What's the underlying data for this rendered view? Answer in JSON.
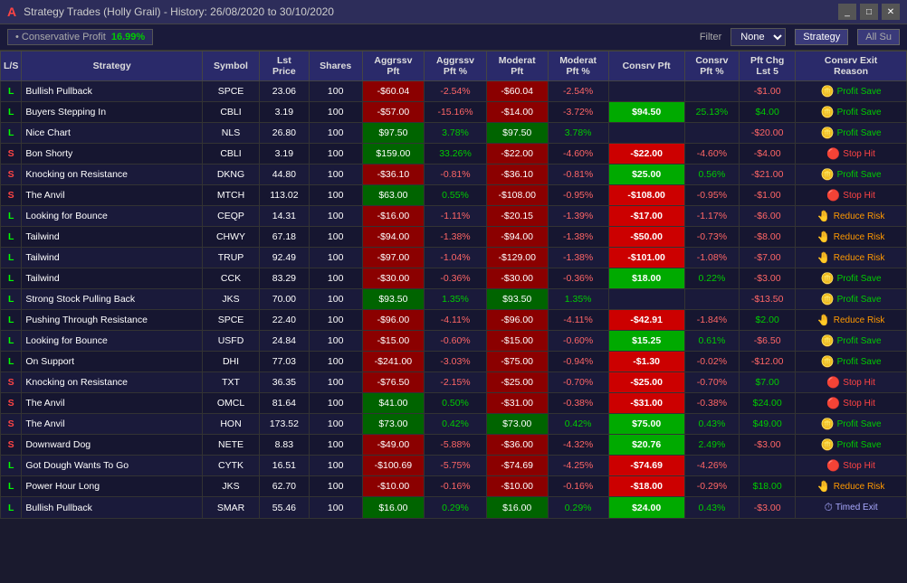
{
  "titleBar": {
    "icon": "A",
    "title": "Strategy Trades (Holly Grail) - History: 26/08/2020 to 30/10/2020",
    "minimizeLabel": "_",
    "maximizeLabel": "□",
    "closeLabel": "✕"
  },
  "toolbar": {
    "profitLabel": "• Conservative Profit",
    "profitValue": "16.99%",
    "filterLabel": "Filter",
    "filterValue": "None",
    "strategyLabel": "Strategy",
    "allLabel": "All Su"
  },
  "tableHeaders": [
    "L/S",
    "Strategy",
    "Symbol",
    "Lst\nPrice",
    "Shares",
    "Aggrssv\nPft",
    "Aggrssv\nPft %",
    "Moderat\nPft",
    "Moderat\nPft %",
    "Consrv Pft",
    "Consrv\nPft %",
    "Pft Chg\nLst 5",
    "Consrv Exit\nReason"
  ],
  "rows": [
    {
      "ls": "L",
      "strategy": "Bullish Pullback",
      "symbol": "SPCE",
      "price": "23.06",
      "shares": "100",
      "aggrPft": "-$60.04",
      "aggrPct": "-2.54%",
      "modPft": "-$60.04",
      "modPct": "-2.54%",
      "consrvPft": "",
      "consrvPct": "",
      "pftChg": "-$1.00",
      "exitIcon": "coin",
      "exitText": "Profit Save",
      "exitType": "profit"
    },
    {
      "ls": "L",
      "strategy": "Buyers Stepping In",
      "symbol": "CBLI",
      "price": "3.19",
      "shares": "100",
      "aggrPft": "-$57.00",
      "aggrPct": "-15.16%",
      "modPft": "-$14.00",
      "modPct": "-3.72%",
      "consrvPft": "$94.50",
      "consrvPct": "25.13%",
      "pftChg": "$4.00",
      "exitIcon": "coin",
      "exitText": "Profit Save",
      "exitType": "profit",
      "highlight": true
    },
    {
      "ls": "L",
      "strategy": "Nice Chart",
      "symbol": "NLS",
      "price": "26.80",
      "shares": "100",
      "aggrPft": "$97.50",
      "aggrPct": "3.78%",
      "modPft": "$97.50",
      "modPct": "3.78%",
      "consrvPft": "",
      "consrvPct": "",
      "pftChg": "-$20.00",
      "exitIcon": "coin",
      "exitText": "Profit Save",
      "exitType": "profit"
    },
    {
      "ls": "S",
      "strategy": "Bon Shorty",
      "symbol": "CBLI",
      "price": "3.19",
      "shares": "100",
      "aggrPft": "$159.00",
      "aggrPct": "33.26%",
      "modPft": "-$22.00",
      "modPct": "-4.60%",
      "consrvPft": "-$22.00",
      "consrvPct": "-4.60%",
      "pftChg": "-$4.00",
      "exitIcon": "stop",
      "exitText": "Stop Hit",
      "exitType": "stop"
    },
    {
      "ls": "S",
      "strategy": "Knocking on Resistance",
      "symbol": "DKNG",
      "price": "44.80",
      "shares": "100",
      "aggrPft": "-$36.10",
      "aggrPct": "-0.81%",
      "modPft": "-$36.10",
      "modPct": "-0.81%",
      "consrvPft": "$25.00",
      "consrvPct": "0.56%",
      "pftChg": "-$21.00",
      "exitIcon": "coin",
      "exitText": "Profit Save",
      "exitType": "profit"
    },
    {
      "ls": "S",
      "strategy": "The Anvil",
      "symbol": "MTCH",
      "price": "113.02",
      "shares": "100",
      "aggrPft": "$63.00",
      "aggrPct": "0.55%",
      "modPft": "-$108.00",
      "modPct": "-0.95%",
      "consrvPft": "-$108.00",
      "consrvPct": "-0.95%",
      "pftChg": "-$1.00",
      "exitIcon": "stop",
      "exitText": "Stop Hit",
      "exitType": "stop"
    },
    {
      "ls": "L",
      "strategy": "Looking for Bounce",
      "symbol": "CEQP",
      "price": "14.31",
      "shares": "100",
      "aggrPft": "-$16.00",
      "aggrPct": "-1.11%",
      "modPft": "-$20.15",
      "modPct": "-1.39%",
      "consrvPft": "-$17.00",
      "consrvPct": "-1.17%",
      "pftChg": "-$6.00",
      "exitIcon": "hand",
      "exitText": "Reduce Risk",
      "exitType": "reduce"
    },
    {
      "ls": "L",
      "strategy": "Tailwind",
      "symbol": "CHWY",
      "price": "67.18",
      "shares": "100",
      "aggrPft": "-$94.00",
      "aggrPct": "-1.38%",
      "modPft": "-$94.00",
      "modPct": "-1.38%",
      "consrvPft": "-$50.00",
      "consrvPct": "-0.73%",
      "pftChg": "-$8.00",
      "exitIcon": "hand",
      "exitText": "Reduce Risk",
      "exitType": "reduce"
    },
    {
      "ls": "L",
      "strategy": "Tailwind",
      "symbol": "TRUP",
      "price": "92.49",
      "shares": "100",
      "aggrPft": "-$97.00",
      "aggrPct": "-1.04%",
      "modPft": "-$129.00",
      "modPct": "-1.38%",
      "consrvPft": "-$101.00",
      "consrvPct": "-1.08%",
      "pftChg": "-$7.00",
      "exitIcon": "hand",
      "exitText": "Reduce Risk",
      "exitType": "reduce"
    },
    {
      "ls": "L",
      "strategy": "Tailwind",
      "symbol": "CCK",
      "price": "83.29",
      "shares": "100",
      "aggrPft": "-$30.00",
      "aggrPct": "-0.36%",
      "modPft": "-$30.00",
      "modPct": "-0.36%",
      "consrvPft": "$18.00",
      "consrvPct": "0.22%",
      "pftChg": "-$3.00",
      "exitIcon": "coin",
      "exitText": "Profit Save",
      "exitType": "profit"
    },
    {
      "ls": "L",
      "strategy": "Strong Stock Pulling Back",
      "symbol": "JKS",
      "price": "70.00",
      "shares": "100",
      "aggrPft": "$93.50",
      "aggrPct": "1.35%",
      "modPft": "$93.50",
      "modPct": "1.35%",
      "consrvPft": "",
      "consrvPct": "",
      "pftChg": "-$13.50",
      "exitIcon": "coin",
      "exitText": "Profit Save",
      "exitType": "profit"
    },
    {
      "ls": "L",
      "strategy": "Pushing Through Resistance",
      "symbol": "SPCE",
      "price": "22.40",
      "shares": "100",
      "aggrPft": "-$96.00",
      "aggrPct": "-4.11%",
      "modPft": "-$96.00",
      "modPct": "-4.11%",
      "consrvPft": "-$42.91",
      "consrvPct": "-1.84%",
      "pftChg": "$2.00",
      "exitIcon": "hand",
      "exitText": "Reduce Risk",
      "exitType": "reduce"
    },
    {
      "ls": "L",
      "strategy": "Looking for Bounce",
      "symbol": "USFD",
      "price": "24.84",
      "shares": "100",
      "aggrPft": "-$15.00",
      "aggrPct": "-0.60%",
      "modPft": "-$15.00",
      "modPct": "-0.60%",
      "consrvPft": "$15.25",
      "consrvPct": "0.61%",
      "pftChg": "-$6.50",
      "exitIcon": "coin",
      "exitText": "Profit Save",
      "exitType": "profit"
    },
    {
      "ls": "L",
      "strategy": "On Support",
      "symbol": "DHI",
      "price": "77.03",
      "shares": "100",
      "aggrPft": "-$241.00",
      "aggrPct": "-3.03%",
      "modPft": "-$75.00",
      "modPct": "-0.94%",
      "consrvPft": "-$1.30",
      "consrvPct": "-0.02%",
      "pftChg": "-$12.00",
      "exitIcon": "coin",
      "exitText": "Profit Save",
      "exitType": "profit"
    },
    {
      "ls": "S",
      "strategy": "Knocking on Resistance",
      "symbol": "TXT",
      "price": "36.35",
      "shares": "100",
      "aggrPft": "-$76.50",
      "aggrPct": "-2.15%",
      "modPft": "-$25.00",
      "modPct": "-0.70%",
      "consrvPft": "-$25.00",
      "consrvPct": "-0.70%",
      "pftChg": "$7.00",
      "exitIcon": "stop",
      "exitText": "Stop Hit",
      "exitType": "stop"
    },
    {
      "ls": "S",
      "strategy": "The Anvil",
      "symbol": "OMCL",
      "price": "81.64",
      "shares": "100",
      "aggrPft": "$41.00",
      "aggrPct": "0.50%",
      "modPft": "-$31.00",
      "modPct": "-0.38%",
      "consrvPft": "-$31.00",
      "consrvPct": "-0.38%",
      "pftChg": "$24.00",
      "exitIcon": "stop",
      "exitText": "Stop Hit",
      "exitType": "stop"
    },
    {
      "ls": "S",
      "strategy": "The Anvil",
      "symbol": "HON",
      "price": "173.52",
      "shares": "100",
      "aggrPft": "$73.00",
      "aggrPct": "0.42%",
      "modPft": "$73.00",
      "modPct": "0.42%",
      "consrvPft": "$75.00",
      "consrvPct": "0.43%",
      "pftChg": "$49.00",
      "exitIcon": "coin",
      "exitText": "Profit Save",
      "exitType": "profit"
    },
    {
      "ls": "S",
      "strategy": "Downward Dog",
      "symbol": "NETE",
      "price": "8.83",
      "shares": "100",
      "aggrPft": "-$49.00",
      "aggrPct": "-5.88%",
      "modPft": "-$36.00",
      "modPct": "-4.32%",
      "consrvPft": "$20.76",
      "consrvPct": "2.49%",
      "pftChg": "-$3.00",
      "exitIcon": "coin",
      "exitText": "Profit Save",
      "exitType": "profit"
    },
    {
      "ls": "L",
      "strategy": "Got Dough Wants To Go",
      "symbol": "CYTK",
      "price": "16.51",
      "shares": "100",
      "aggrPft": "-$100.69",
      "aggrPct": "-5.75%",
      "modPft": "-$74.69",
      "modPct": "-4.25%",
      "consrvPft": "-$74.69",
      "consrvPct": "-4.26%",
      "pftChg": "",
      "exitIcon": "stop",
      "exitText": "Stop Hit",
      "exitType": "stop"
    },
    {
      "ls": "L",
      "strategy": "Power Hour Long",
      "symbol": "JKS",
      "price": "62.70",
      "shares": "100",
      "aggrPft": "-$10.00",
      "aggrPct": "-0.16%",
      "modPft": "-$10.00",
      "modPct": "-0.16%",
      "consrvPft": "-$18.00",
      "consrvPct": "-0.29%",
      "pftChg": "$18.00",
      "exitIcon": "hand",
      "exitText": "Reduce Risk",
      "exitType": "reduce"
    },
    {
      "ls": "L",
      "strategy": "Bullish Pullback",
      "symbol": "SMAR",
      "price": "55.46",
      "shares": "100",
      "aggrPft": "$16.00",
      "aggrPct": "0.29%",
      "modPft": "$16.00",
      "modPct": "0.29%",
      "consrvPft": "$24.00",
      "consrvPct": "0.43%",
      "pftChg": "-$3.00",
      "exitIcon": "timed",
      "exitText": "Timed Exit",
      "exitType": "timed"
    }
  ]
}
